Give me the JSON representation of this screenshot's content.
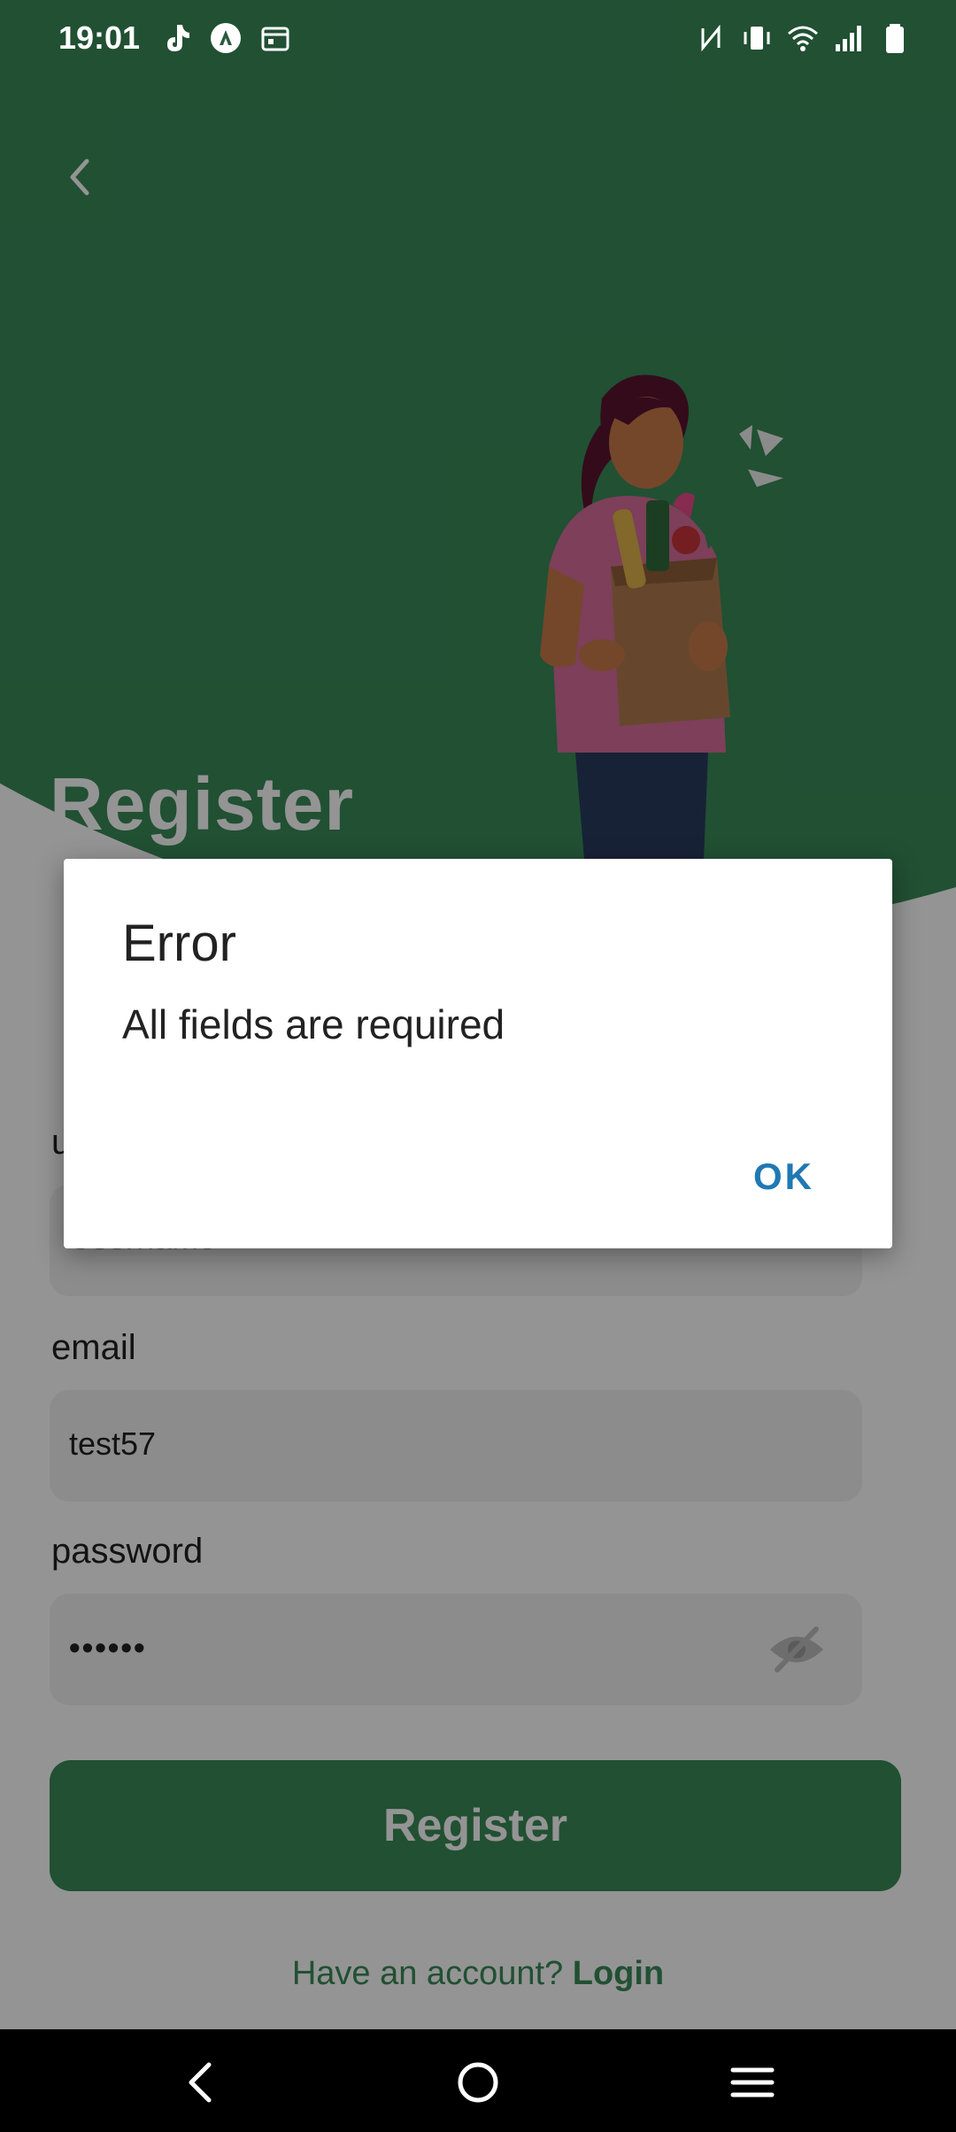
{
  "status_bar": {
    "time": "19:01",
    "left_icons": [
      "tiktok-icon",
      "app-icon",
      "calendar-icon"
    ],
    "right_icons": [
      "nfc-icon",
      "vibrate-icon",
      "wifi-icon",
      "signal-icon",
      "battery-icon"
    ]
  },
  "header": {
    "back_icon": "chevron-left-icon",
    "title": "Register"
  },
  "form": {
    "username_label": "username",
    "username_placeholder": "Username",
    "email_label": "email",
    "email_value": "test57",
    "password_label": "password",
    "password_value": "••••••",
    "password_icon": "eye-off-icon",
    "submit_label": "Register",
    "account_prompt": "Have an account?",
    "login_link": "Login"
  },
  "dialog": {
    "title": "Error",
    "message": "All fields are required",
    "ok_label": "OK"
  },
  "nav_bar": {
    "buttons": [
      "back-icon",
      "home-icon",
      "menu-icon"
    ]
  },
  "colors": {
    "brand_green": "#3a8a59",
    "dialog_accent": "#1f78b4"
  }
}
